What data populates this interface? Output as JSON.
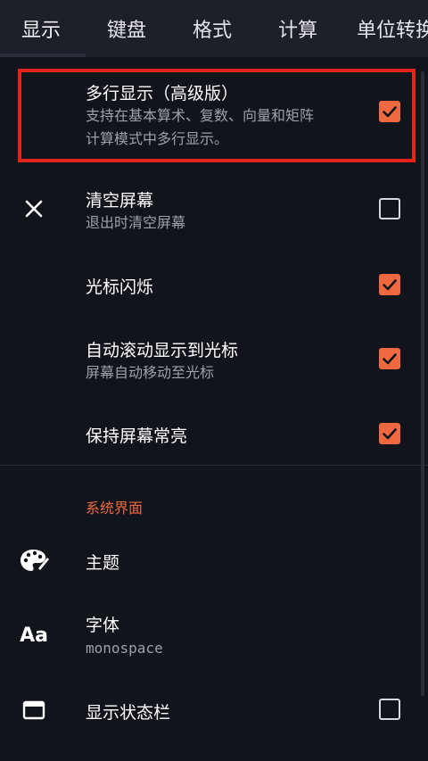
{
  "tabs": [
    {
      "label": "显示",
      "active": true
    },
    {
      "label": "键盘",
      "active": false
    },
    {
      "label": "格式",
      "active": false
    },
    {
      "label": "计算",
      "active": false
    },
    {
      "label": "单位转换",
      "active": false
    }
  ],
  "settings": [
    {
      "title": "多行显示（高级版）",
      "summary_lines": [
        "支持在基本算术、复数、向量和矩阵",
        "计算模式中多行显示。"
      ],
      "checked": true,
      "highlighted": true
    },
    {
      "title": "清空屏幕",
      "summary": "退出时清空屏幕",
      "checked": false,
      "icon": "close-icon"
    },
    {
      "title": "光标闪烁",
      "checked": true
    },
    {
      "title": "自动滚动显示到光标",
      "summary": "屏幕自动移动至光标",
      "checked": true
    },
    {
      "title": "保持屏幕常亮",
      "checked": true
    }
  ],
  "system_section": {
    "header": "系统界面",
    "items": [
      {
        "title": "主题",
        "icon": "palette-icon"
      },
      {
        "title": "字体",
        "summary": "monospace",
        "icon_text": "Aa",
        "icon": "font-icon"
      },
      {
        "title": "显示状态栏",
        "checked": false,
        "icon": "window-icon"
      }
    ]
  },
  "colors": {
    "accent": "#f0683f",
    "background": "#12141b",
    "tabbar": "#1d2029",
    "highlight_border": "#e3241b"
  }
}
